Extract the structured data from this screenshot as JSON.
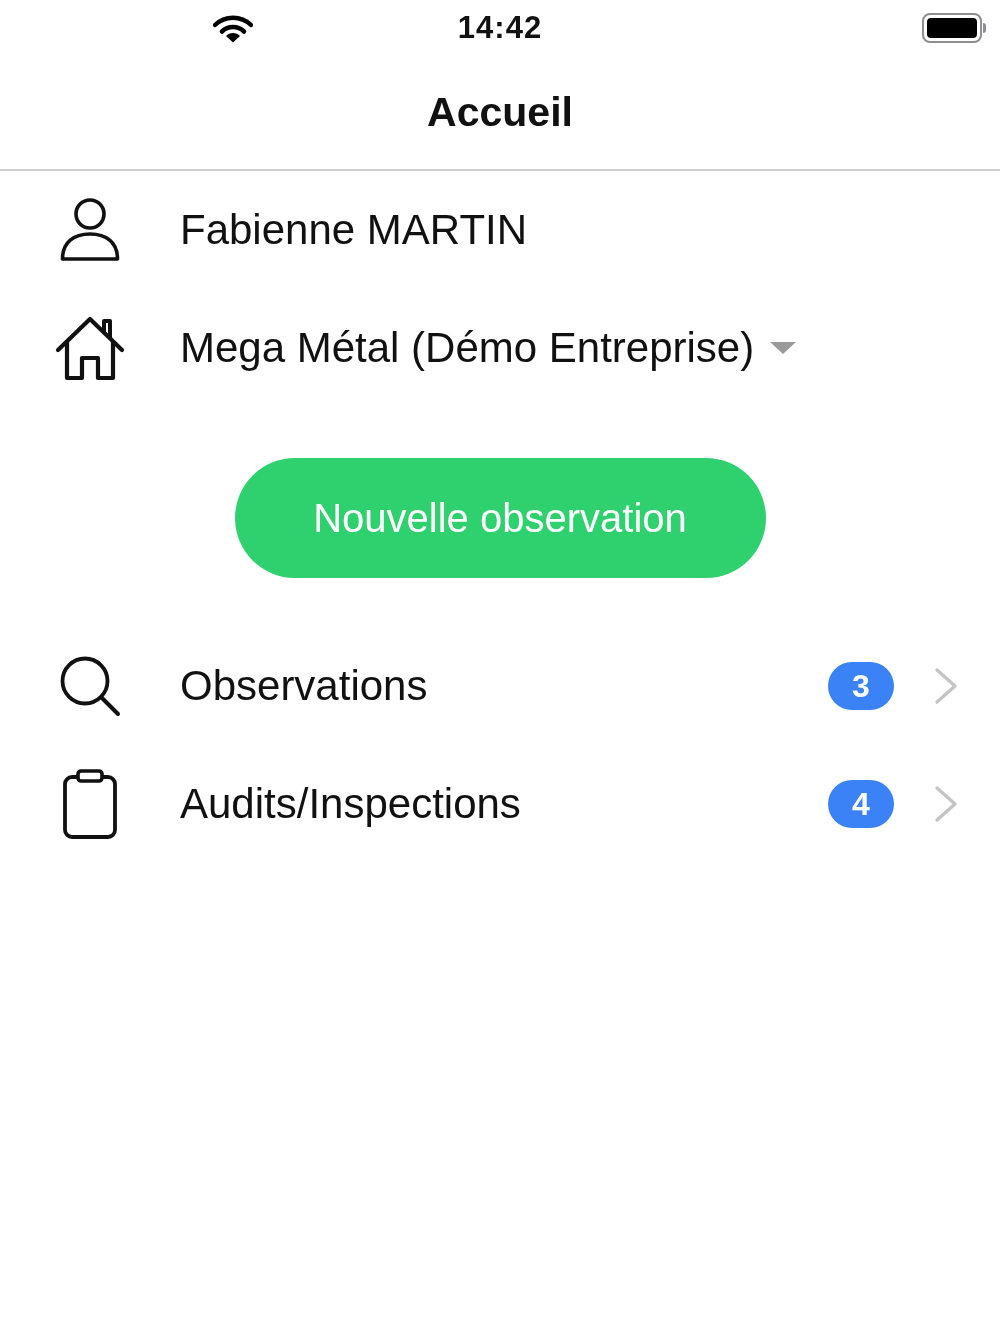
{
  "status_bar": {
    "time": "14:42"
  },
  "nav": {
    "title": "Accueil"
  },
  "profile": [
    {
      "kind": "user",
      "label": "Fabienne MARTIN",
      "dropdown": false
    },
    {
      "kind": "company",
      "label": "Mega Métal (Démo Entreprise)",
      "dropdown": true
    }
  ],
  "primary_button": {
    "label": "Nouvelle observation"
  },
  "menu": [
    {
      "kind": "observations",
      "label": "Observations",
      "badge": "3"
    },
    {
      "kind": "audits",
      "label": "Audits/Inspections",
      "badge": "4"
    }
  ]
}
